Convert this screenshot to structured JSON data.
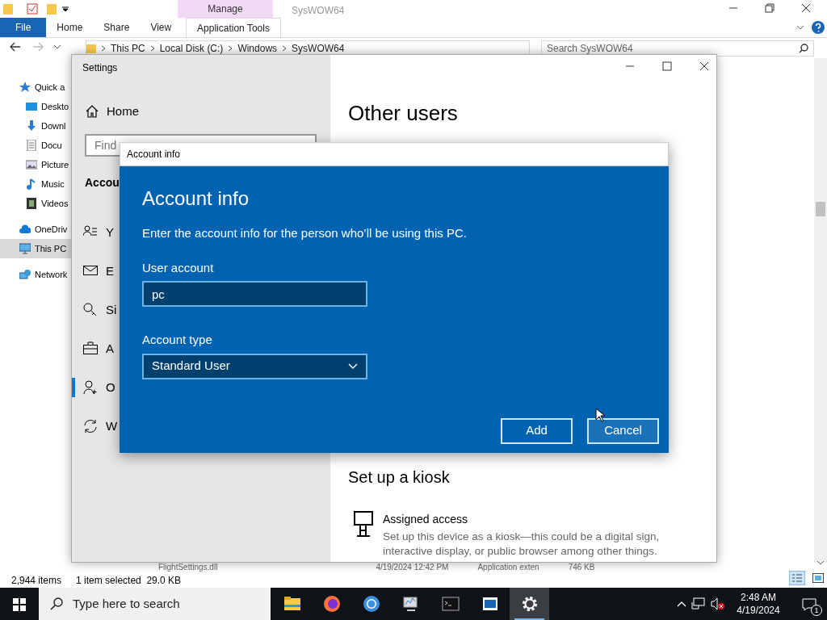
{
  "explorer": {
    "context_tab": "Manage",
    "title": "SysWOW64",
    "ribbon_tabs": [
      {
        "label": "File",
        "kind": "file",
        "selected": false
      },
      {
        "label": "Home",
        "kind": "tab",
        "selected": false
      },
      {
        "label": "Share",
        "kind": "tab",
        "selected": false
      },
      {
        "label": "View",
        "kind": "tab",
        "selected": false
      },
      {
        "label": "Application Tools",
        "kind": "context",
        "selected": true
      }
    ],
    "address": [
      "This PC",
      "Local Disk (C:)",
      "Windows",
      "SysWOW64"
    ],
    "search": {
      "placeholder": "Search SysWOW64"
    },
    "nav": [
      {
        "label": "Quick a",
        "kind": "star",
        "selected": false
      },
      {
        "label": "Deskto",
        "kind": "desktop",
        "selected": false
      },
      {
        "label": "Downl",
        "kind": "download",
        "selected": false
      },
      {
        "label": "Docu",
        "kind": "document",
        "selected": false
      },
      {
        "label": "Picture",
        "kind": "picture",
        "selected": false
      },
      {
        "label": "Music",
        "kind": "music",
        "selected": false
      },
      {
        "label": "Videos",
        "kind": "video",
        "selected": false
      },
      {
        "label": "OneDriv",
        "kind": "cloud",
        "selected": false
      },
      {
        "label": "This PC",
        "kind": "pc",
        "selected": true
      },
      {
        "label": "Network",
        "kind": "network",
        "selected": false
      }
    ],
    "file_row": [
      "FlightSettings.dll",
      "4/19/2024 12:42 PM",
      "Application exten",
      "746 KB"
    ],
    "status": {
      "items": "2,944 items",
      "selection": "1 item selected  29.0 KB"
    }
  },
  "settings": {
    "title": "Settings",
    "home": "Home",
    "search": {
      "placeholder": "Find"
    },
    "section": "Accou",
    "nav": [
      {
        "label": "Y",
        "kind": "info",
        "selected": false
      },
      {
        "label": "E",
        "kind": "mail",
        "selected": false
      },
      {
        "label": "Si",
        "kind": "key",
        "selected": false
      },
      {
        "label": "A",
        "kind": "work",
        "selected": false
      },
      {
        "label": "O",
        "kind": "adduser",
        "selected": true
      },
      {
        "label": "W",
        "kind": "sync",
        "selected": false
      }
    ],
    "heading": "Other users",
    "kiosk": {
      "heading": "Set up a kiosk",
      "title": "Assigned access",
      "description": "Set up this device as a kiosk—this could be a digital sign, interactive display, or public browser among other things."
    }
  },
  "dialog": {
    "title": "Account info",
    "heading": "Account info",
    "intro": "Enter the account info for the person who’ll be using this PC.",
    "user_label": "User account",
    "user_value": "pc",
    "type_label": "Account type",
    "type_value": "Standard User",
    "buttons": [
      {
        "label": "Add",
        "hovered": false
      },
      {
        "label": "Cancel",
        "hovered": true
      }
    ]
  },
  "taskbar": {
    "search": {
      "placeholder": "Type here to search"
    },
    "apps": [
      {
        "kind": "explorer",
        "active": false
      },
      {
        "kind": "firefox",
        "active": false
      },
      {
        "kind": "chrome",
        "active": false
      },
      {
        "kind": "monitor",
        "active": false
      },
      {
        "kind": "terminal",
        "active": false
      },
      {
        "kind": "window",
        "active": false
      },
      {
        "kind": "gear",
        "active": true
      }
    ],
    "time": "2:48 AM",
    "date": "4/19/2024",
    "notifications": "1"
  }
}
